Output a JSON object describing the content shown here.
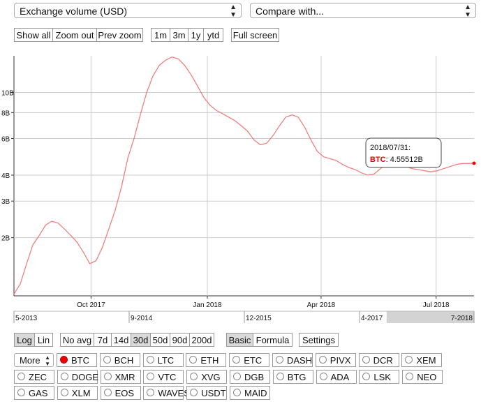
{
  "metric_select": {
    "value": "Exchange volume (USD)"
  },
  "compare_select": {
    "value": "Compare with..."
  },
  "zoom_buttons": [
    "Show all",
    "Zoom out",
    "Prev zoom"
  ],
  "range_buttons": [
    "1m",
    "3m",
    "1y",
    "ytd"
  ],
  "fullscreen_label": "Full screen",
  "scale_buttons": [
    {
      "label": "Log",
      "active": true
    },
    {
      "label": "Lin",
      "active": false
    }
  ],
  "avg_buttons": [
    {
      "label": "No avg",
      "active": false
    },
    {
      "label": "7d",
      "active": false
    },
    {
      "label": "14d",
      "active": false
    },
    {
      "label": "30d",
      "active": true
    },
    {
      "label": "50d",
      "active": false
    },
    {
      "label": "90d",
      "active": false
    },
    {
      "label": "200d",
      "active": false
    }
  ],
  "mode_buttons": [
    {
      "label": "Basic",
      "active": true
    },
    {
      "label": "Formula",
      "active": false
    }
  ],
  "settings_label": "Settings",
  "more_select": {
    "value": "More"
  },
  "coins": [
    [
      "BTC",
      "BCH",
      "LTC",
      "ETH",
      "ETC",
      "DASH",
      "PIVX",
      "DCR",
      "XEM"
    ],
    [
      "ZEC",
      "DOGE",
      "XMR",
      "VTC",
      "XVG",
      "DGB",
      "BTG",
      "ADA",
      "LSK",
      "NEO"
    ],
    [
      "GAS",
      "XLM",
      "EOS",
      "WAVES",
      "USDT",
      "MAID"
    ]
  ],
  "selected_coin": "BTC",
  "colors": {
    "series": "#f08080",
    "marker": "#ff0000",
    "selected_radio": "#e00000"
  },
  "tooltip": {
    "date": "2018/07/31:",
    "series": "BTC",
    "value": ": 4.55512B"
  },
  "chart_data": {
    "type": "line",
    "ylabel": "",
    "y_scale": "log",
    "y_ticks": [
      "2B",
      "3B",
      "4B",
      "6B",
      "8B",
      "10B"
    ],
    "y_tick_values": [
      2,
      3,
      4,
      6,
      8,
      10
    ],
    "ylim": [
      1.05,
      15
    ],
    "x_ticks": [
      "Oct 2017",
      "Jan 2018",
      "Apr 2018",
      "Jul 2018"
    ],
    "x_tick_dates": [
      "2017-10-01",
      "2018-01-01",
      "2018-04-01",
      "2018-07-01"
    ],
    "xlim": [
      "2017-08-01",
      "2018-07-31"
    ],
    "grid": true,
    "series": [
      {
        "name": "BTC",
        "unit": "B USD",
        "dates": [
          "2017-08-01",
          "2017-08-06",
          "2017-08-11",
          "2017-08-16",
          "2017-08-21",
          "2017-08-26",
          "2017-08-31",
          "2017-09-05",
          "2017-09-10",
          "2017-09-15",
          "2017-09-20",
          "2017-09-25",
          "2017-09-30",
          "2017-10-05",
          "2017-10-10",
          "2017-10-15",
          "2017-10-20",
          "2017-10-25",
          "2017-10-30",
          "2017-11-04",
          "2017-11-09",
          "2017-11-14",
          "2017-11-19",
          "2017-11-24",
          "2017-11-29",
          "2017-12-04",
          "2017-12-09",
          "2017-12-14",
          "2017-12-19",
          "2017-12-24",
          "2017-12-29",
          "2018-01-03",
          "2018-01-08",
          "2018-01-13",
          "2018-01-18",
          "2018-01-23",
          "2018-01-28",
          "2018-02-02",
          "2018-02-07",
          "2018-02-12",
          "2018-02-17",
          "2018-02-22",
          "2018-02-27",
          "2018-03-04",
          "2018-03-09",
          "2018-03-14",
          "2018-03-19",
          "2018-03-24",
          "2018-03-29",
          "2018-04-03",
          "2018-04-08",
          "2018-04-13",
          "2018-04-18",
          "2018-04-23",
          "2018-04-28",
          "2018-05-03",
          "2018-05-08",
          "2018-05-13",
          "2018-05-18",
          "2018-05-23",
          "2018-05-28",
          "2018-06-02",
          "2018-06-07",
          "2018-06-12",
          "2018-06-17",
          "2018-06-22",
          "2018-06-27",
          "2018-07-02",
          "2018-07-07",
          "2018-07-12",
          "2018-07-17",
          "2018-07-22",
          "2018-07-27",
          "2018-07-31"
        ],
        "values": [
          1.07,
          1.2,
          1.5,
          1.85,
          2.05,
          2.3,
          2.4,
          2.35,
          2.2,
          2.05,
          1.9,
          1.7,
          1.5,
          1.55,
          1.8,
          2.2,
          2.7,
          3.5,
          4.8,
          6.0,
          7.8,
          10.0,
          12.0,
          13.5,
          14.3,
          14.8,
          14.5,
          13.5,
          12.2,
          10.8,
          9.5,
          8.7,
          8.2,
          7.9,
          7.6,
          7.3,
          6.9,
          6.5,
          5.9,
          5.6,
          5.7,
          6.2,
          6.9,
          7.6,
          7.8,
          7.6,
          6.8,
          5.9,
          5.2,
          4.9,
          4.8,
          4.7,
          4.5,
          4.35,
          4.25,
          4.1,
          4.0,
          4.05,
          4.3,
          4.5,
          4.55,
          4.5,
          4.4,
          4.3,
          4.25,
          4.2,
          4.15,
          4.2,
          4.3,
          4.4,
          4.5,
          4.55,
          4.55,
          4.56
        ]
      }
    ]
  },
  "navigator": {
    "labels": [
      "5-2013",
      "9-2014",
      "12-2015",
      "4-2017",
      "7-2018"
    ],
    "selection_start": 0.81
  }
}
